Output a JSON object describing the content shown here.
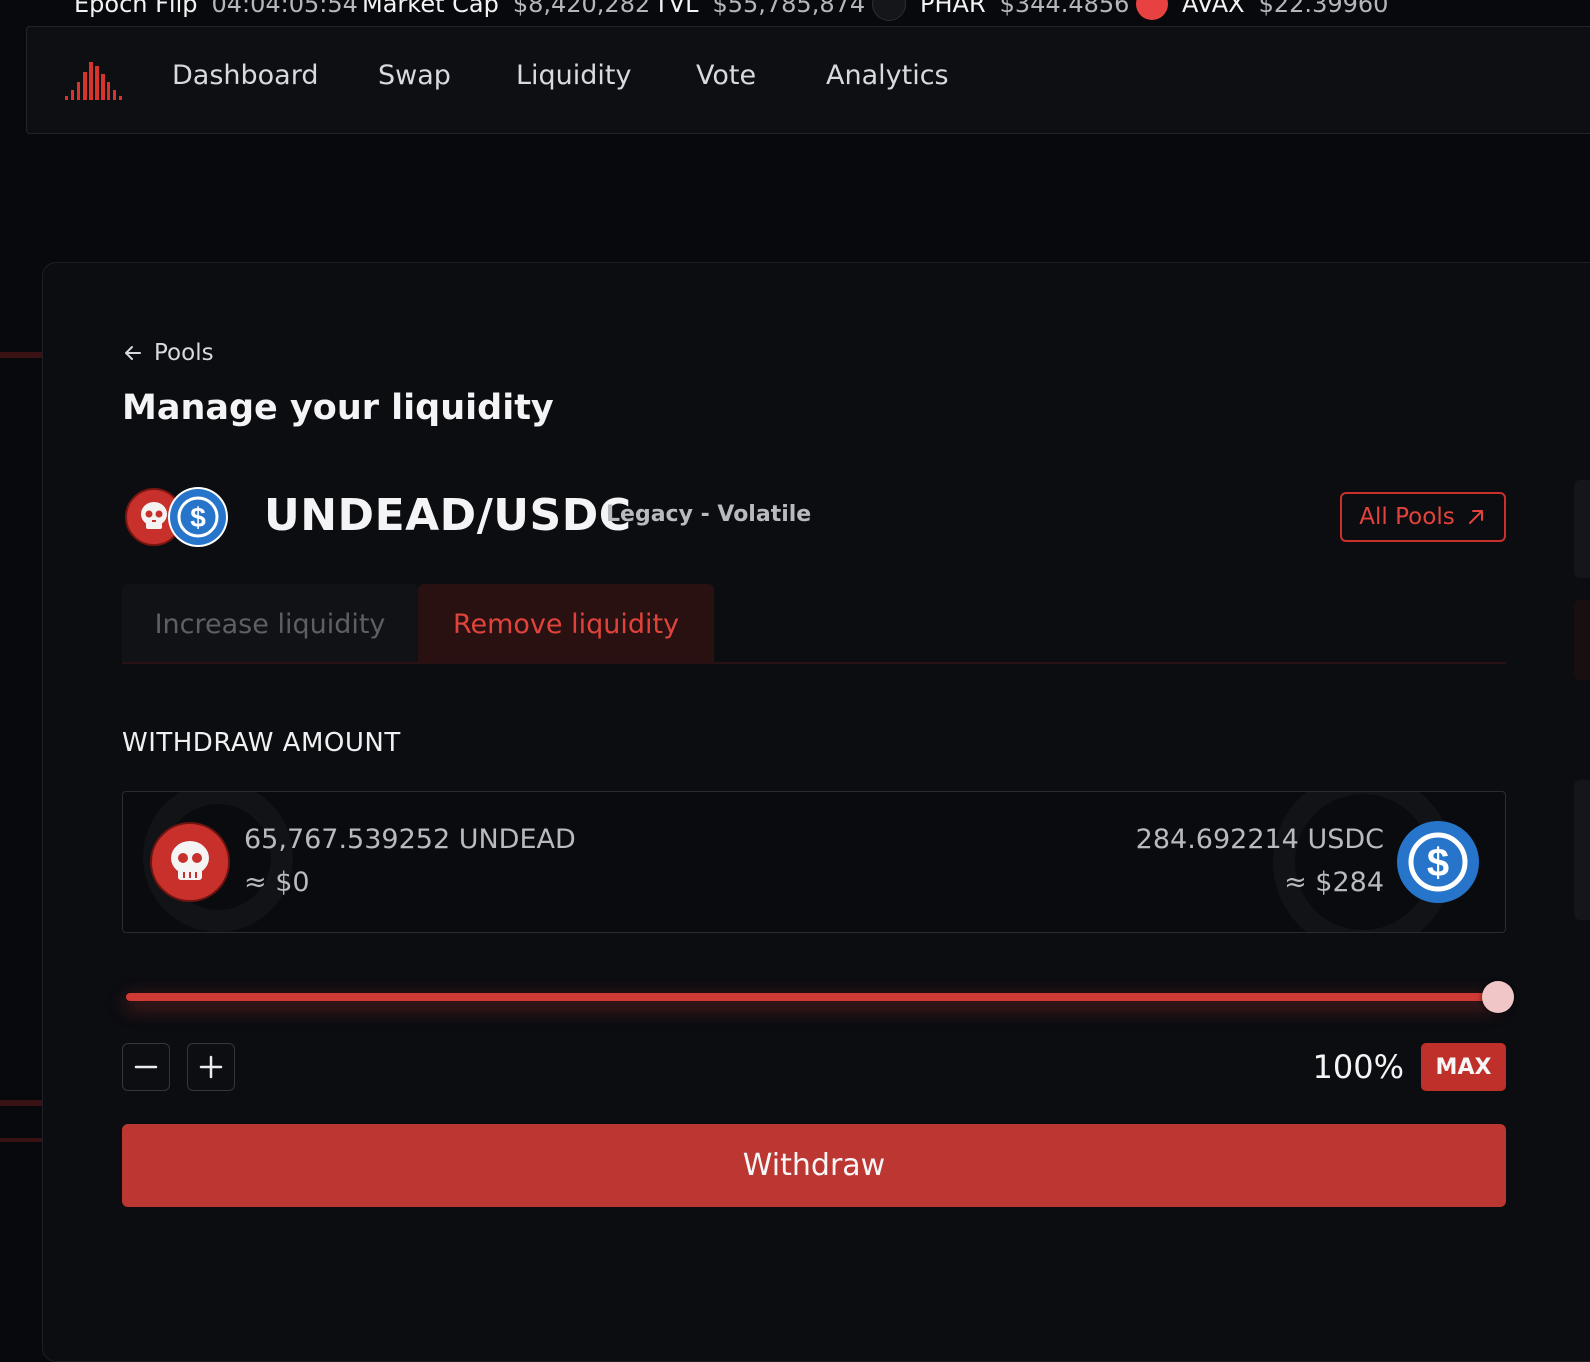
{
  "ticker": {
    "items": [
      {
        "label": "Epoch Flip",
        "value": "04:04:05:54"
      },
      {
        "label": "Market Cap",
        "value": "$8,420,282"
      },
      {
        "label": "TVL",
        "value": "$55,785,874"
      },
      {
        "label": "PHAR",
        "value": "$344.4856"
      },
      {
        "label": "AVAX",
        "value": "$22.39960"
      }
    ]
  },
  "nav": {
    "links": [
      "Dashboard",
      "Swap",
      "Liquidity",
      "Vote",
      "Analytics"
    ]
  },
  "page": {
    "back_label": "Pools",
    "title": "Manage your liquidity"
  },
  "pool": {
    "pair": "UNDEAD/USDC",
    "type": "Legacy - Volatile",
    "all_pools_label": "All Pools"
  },
  "tabs": {
    "increase": "Increase liquidity",
    "remove": "Remove liquidity",
    "active": "remove"
  },
  "withdraw": {
    "section_label": "WITHDRAW AMOUNT",
    "token0": {
      "amount": "65,767.539252 UNDEAD",
      "usd": "≈ $0",
      "icon": "skull-token-icon"
    },
    "token1": {
      "amount": "284.692214 USDC",
      "usd": "≈ $284",
      "icon": "usdc-token-icon"
    },
    "percent_value": 100,
    "percent_label": "100%",
    "max_label": "MAX",
    "button_label": "Withdraw"
  },
  "colors": {
    "accent": "#c0302b",
    "accent_text": "#e0433c",
    "usdc_blue": "#2775ca",
    "background": "#08090c"
  }
}
